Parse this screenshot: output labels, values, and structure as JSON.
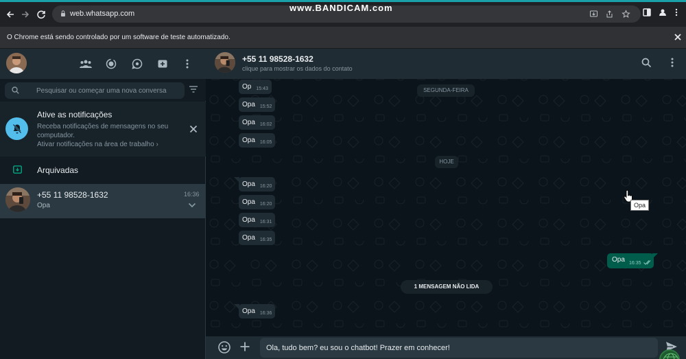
{
  "browser": {
    "url": "web.whatsapp.com",
    "watermark": "www.BANDICAM.com",
    "automation_message": "O Chrome está sendo controlado por um software de teste automatizado.",
    "accent_color": "#1aa0a8"
  },
  "sidebar": {
    "header_icons": [
      "communities-icon",
      "status-icon",
      "channels-icon",
      "new-community-icon",
      "menu-icon"
    ],
    "search": {
      "placeholder": "Pesquisar ou começar uma nova conversa"
    },
    "notification": {
      "title": "Ative as notificações",
      "body": "Receba notificações de mensagens no seu computador.",
      "link": "Ativar notificações na área de trabalho ›"
    },
    "archived_label": "Arquivadas",
    "chats": [
      {
        "name": "+55 11 98528-1632",
        "last_message": "Opa",
        "time": "16:36"
      }
    ]
  },
  "conversation": {
    "contact_name": "+55 11 98528-1632",
    "contact_subtitle": "clique para mostrar os dados do contato",
    "date_separators": [
      "SEGUNDA-FEIRA",
      "HOJE"
    ],
    "unread_label": "1 MENSAGEM NÃO LIDA",
    "incoming": [
      {
        "text": "Op",
        "time": "15:43"
      },
      {
        "text": "Opa",
        "time": "15:52"
      },
      {
        "text": "Opa",
        "time": "16:02"
      },
      {
        "text": "Opa",
        "time": "16:05"
      },
      {
        "text": "Opa",
        "time": "16:20"
      },
      {
        "text": "Opa",
        "time": "16:20"
      },
      {
        "text": "Opa",
        "time": "16:31"
      },
      {
        "text": "Opa",
        "time": "16:35"
      },
      {
        "text": "Opa",
        "time": "16:36"
      }
    ],
    "outgoing": {
      "text": "Opa",
      "time": "16:35"
    },
    "tooltip": "Opa",
    "composer_text": "Ola, tudo bem? eu sou o chatbot! Prazer em conhecer!",
    "colors": {
      "outgoing_bubble": "#005c4b",
      "incoming_bubble": "#202c33",
      "background": "#0b141a"
    }
  }
}
